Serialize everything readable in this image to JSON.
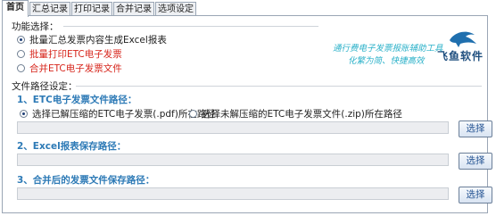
{
  "tabs": [
    "首页",
    "汇总记录",
    "打印记录",
    "合并记录",
    "选项设定"
  ],
  "function_group": {
    "title": "功能选择：",
    "options": [
      {
        "label": "批量汇总发票内容生成Excel报表",
        "selected": true,
        "color": "#222222"
      },
      {
        "label": "批量打印ETC电子发票",
        "selected": false,
        "color": "#d7261c"
      },
      {
        "label": "合并ETC电子发票文件",
        "selected": false,
        "color": "#d7261c"
      }
    ]
  },
  "promo": {
    "slogan_line1": "通行费电子发票报账辅助工具",
    "slogan_line2": "化繁为简、快捷高效",
    "brand_name": "飞鱼软件",
    "logo_icon": "dolphin-icon"
  },
  "path_group": {
    "title": "文件路径设定：",
    "section1": {
      "title": "1、ETC电子发票文件路径：",
      "option_pdf": "选择已解压缩的ETC电子发票(.pdf)所在路径",
      "option_zip": "选择未解压缩的ETC电子发票文件(.zip)所在路径",
      "selected": "pdf",
      "path_value": "",
      "button_label": "选择"
    },
    "section2": {
      "title": "2、Excel报表保存路径：",
      "path_value": "",
      "button_label": "选择"
    },
    "section3": {
      "title": "3、合并后的发票文件保存路径：",
      "path_value": "",
      "button_label": "选择"
    }
  },
  "colors": {
    "accent": "#2d7ab6",
    "red": "#d7261c",
    "slogan": "#2bb1c9"
  }
}
